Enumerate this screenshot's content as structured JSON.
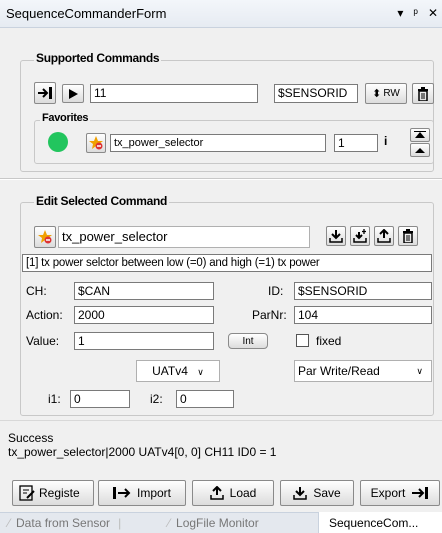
{
  "window": {
    "title": "SequenceCommanderForm",
    "pin_glyph": "▾ ᵖ ✕"
  },
  "supported": {
    "title": "Supported Commands",
    "id_value": "11",
    "sensor_value": "$SENSORID",
    "rw_label": "RW",
    "favorites_title": "Favorites",
    "favorite_name": "tx_power_selector",
    "favorite_index": "1",
    "favorite_info": "i"
  },
  "edit": {
    "title": "Edit Selected Command",
    "command_name": "tx_power_selector",
    "description": "[1] tx power selctor between low (=0) and high (=1) tx power",
    "ch_label": "CH:",
    "ch_value": "$CAN",
    "id_label": "ID:",
    "id_value": "$SENSORID",
    "action_label": "Action:",
    "action_value": "2000",
    "parnr_label": "ParNr:",
    "parnr_value": "104",
    "value_label": "Value:",
    "value_value": "1",
    "int_label": "Int",
    "fixed_label": "fixed",
    "protocol_value": "UATv4",
    "mode_value": "Par Write/Read",
    "i1_label": "i1:",
    "i1_value": "0",
    "i2_label": "i2:",
    "i2_value": "0"
  },
  "status": {
    "line1": "Success",
    "line2": "tx_power_selector|2000 UATv4[0, 0] CH11 ID0 = 1"
  },
  "toolbar": {
    "register_label": "Registe",
    "import_label": "Import",
    "load_label": "Load",
    "save_label": "Save",
    "export_label": "Export"
  },
  "tabs": [
    "Data from Sensor",
    "LogFile Monitor",
    "SequenceCom..."
  ],
  "colors": {
    "favorite_dot": "#22c55e",
    "delete_red": "#d33",
    "star": "#f0a000"
  }
}
